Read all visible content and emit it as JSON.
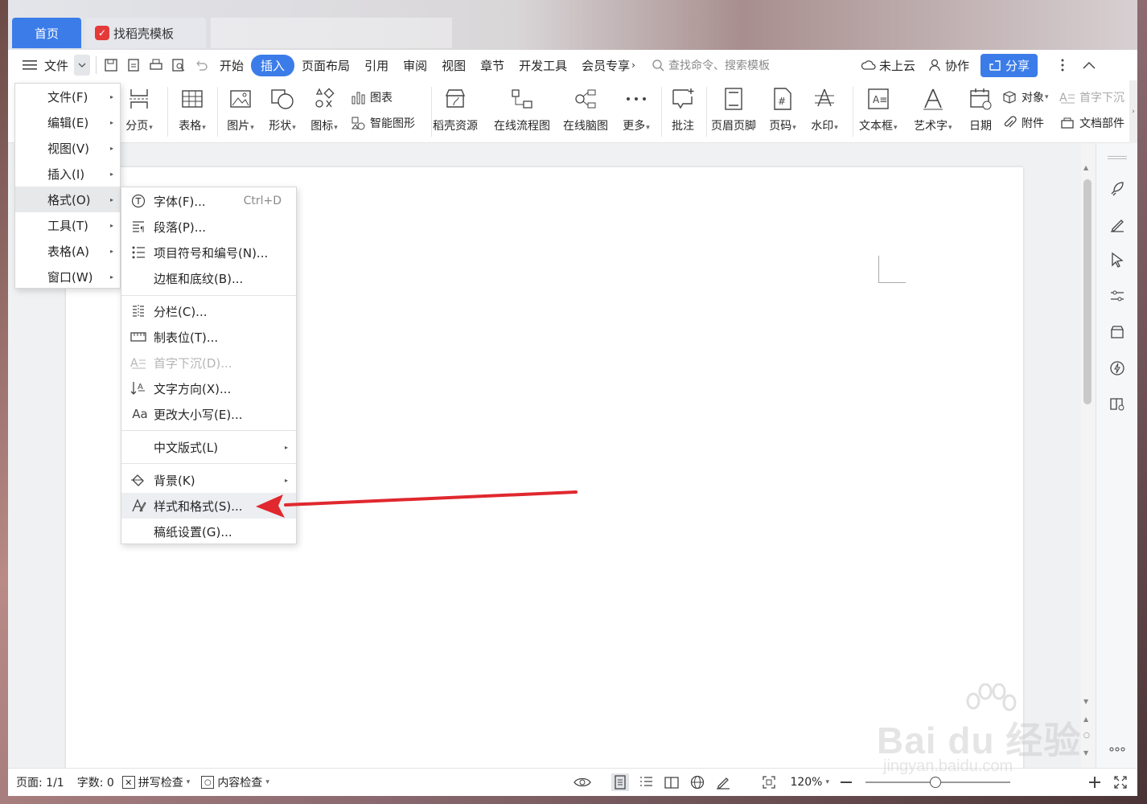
{
  "tabs": {
    "home": "首页",
    "template": "找稻壳模板"
  },
  "menubar": {
    "file_label": "文件",
    "items": [
      "开始",
      "插入",
      "页面布局",
      "引用",
      "审阅",
      "视图",
      "章节",
      "开发工具",
      "会员专享"
    ],
    "active": "插入",
    "search_placeholder": "查找命令、搜索模板",
    "cloud": "未上云",
    "collab": "协作",
    "share": "分享"
  },
  "ribbon": {
    "page_break": "分页",
    "table": "表格",
    "picture": "图片",
    "shape": "形状",
    "icon": "图标",
    "chart": "图表",
    "smart_art": "智能图形",
    "docer_res": "稻壳资源",
    "flowchart": "在线流程图",
    "mindmap": "在线脑图",
    "more": "更多",
    "comment": "批注",
    "header_footer": "页眉页脚",
    "page_num": "页码",
    "watermark": "水印",
    "textbox": "文本框",
    "wordart": "艺术字",
    "date": "日期",
    "object": "对象",
    "attachment": "附件",
    "drop_cap": "首字下沉",
    "doc_parts": "文档部件"
  },
  "main_menu": {
    "items": [
      {
        "label": "文件(F)"
      },
      {
        "label": "编辑(E)"
      },
      {
        "label": "视图(V)"
      },
      {
        "label": "插入(I)"
      },
      {
        "label": "格式(O)"
      },
      {
        "label": "工具(T)"
      },
      {
        "label": "表格(A)"
      },
      {
        "label": "窗口(W)"
      }
    ],
    "selected": "格式(O)"
  },
  "sub_menu": {
    "font": "字体(F)...",
    "font_shortcut": "Ctrl+D",
    "paragraph": "段落(P)...",
    "bullets": "项目符号和编号(N)...",
    "borders": "边框和底纹(B)...",
    "columns": "分栏(C)...",
    "tabs": "制表位(T)...",
    "drop_cap": "首字下沉(D)...",
    "text_dir": "文字方向(X)...",
    "change_case": "更改大小写(E)...",
    "cn_layout": "中文版式(L)",
    "background": "背景(K)",
    "styles": "样式和格式(S)...",
    "manuscript": "稿纸设置(G)..."
  },
  "statusbar": {
    "page": "页面: 1/1",
    "words": "字数: 0",
    "spell": "拼写检查",
    "content_check": "内容检查",
    "zoom": "120%"
  },
  "watermark": {
    "brand": "Bai du 经验",
    "url": "jingyan.baidu.com"
  },
  "colors": {
    "accent": "#3b7ce9",
    "arrow": "#e0282e"
  }
}
